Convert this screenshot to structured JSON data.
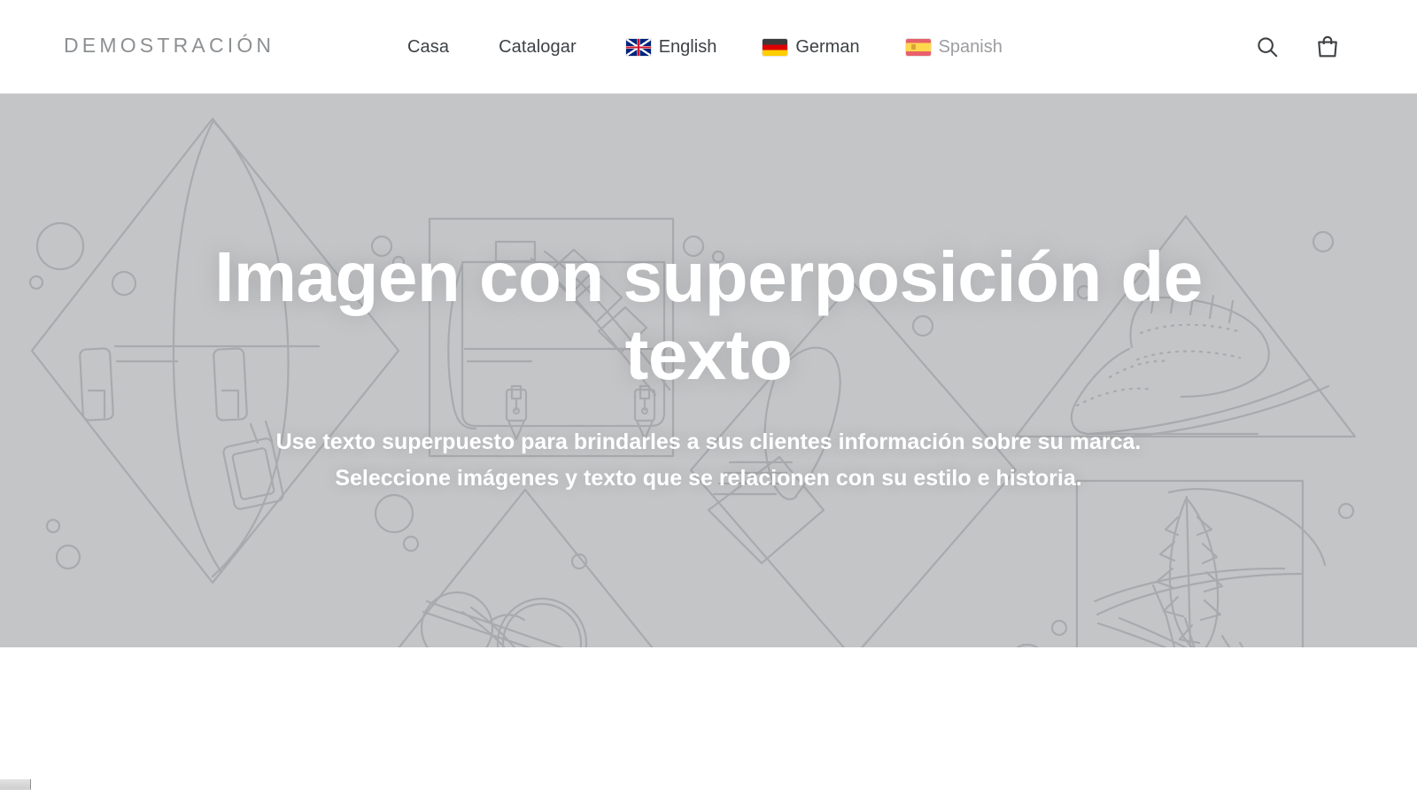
{
  "header": {
    "logo": "DEMOSTRACIÓN",
    "nav": [
      {
        "label": "Casa",
        "name": "nav-link-casa"
      },
      {
        "label": "Catalogar",
        "name": "nav-link-catalogar"
      }
    ],
    "languages": [
      {
        "label": "English",
        "flag": "uk-flag-icon",
        "current": false
      },
      {
        "label": "German",
        "flag": "german-flag-icon",
        "current": false
      },
      {
        "label": "Spanish",
        "flag": "spanish-flag-icon",
        "current": true
      }
    ],
    "actions": [
      {
        "label": "Buscar",
        "icon": "search-icon"
      },
      {
        "label": "Carrito",
        "icon": "shopping-bag-icon"
      }
    ]
  },
  "hero": {
    "title": "Imagen con superposición de texto",
    "text": "Use texto superpuesto para brindarles a sus clientes información sobre su marca. Seleccione imágenes y texto que se relacionen con su estilo e historia.",
    "background_color": "#c4c5c7",
    "line_color": "#a8aaad",
    "text_color": "#ffffff"
  },
  "colors": {
    "nav_text": "#3d4246",
    "logo_text": "#8d9093",
    "muted_text": "#9b9da0",
    "header_background": "#ffffff",
    "page_background": "#ffffff"
  },
  "scrollbar": {
    "orientation": "horizontal",
    "thumb_position": "left"
  }
}
